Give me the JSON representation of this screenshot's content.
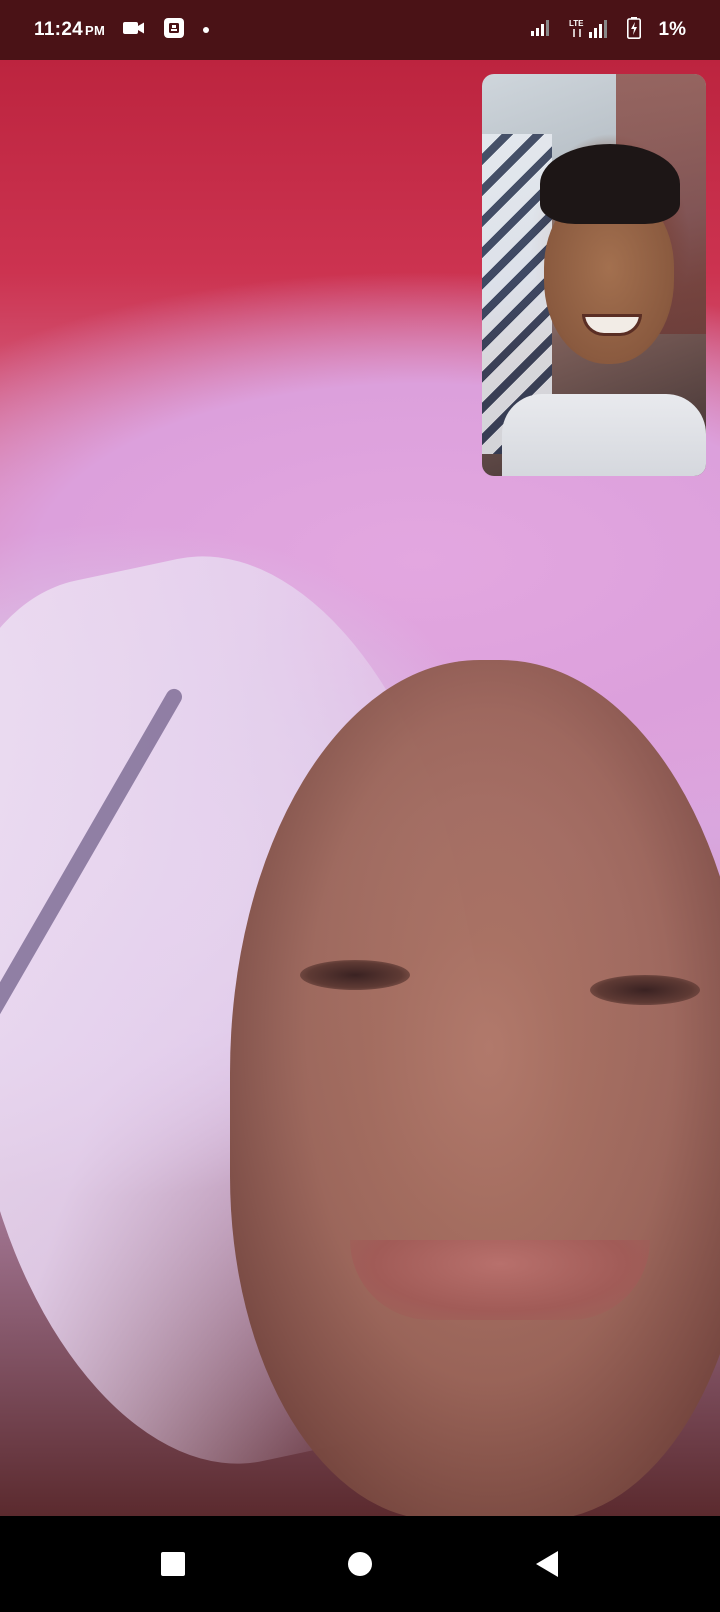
{
  "status_bar": {
    "time": "11:24",
    "ampm": "PM",
    "network_label": "LTE",
    "battery_percent": "1%",
    "icons": [
      "video-camera-icon",
      "screen-record-icon",
      "notification-dot-icon",
      "signal-bars-icon",
      "lte-signal-icon",
      "battery-icon"
    ]
  },
  "call": {
    "remote_video": "remote-participant-video",
    "local_preview": "self-view-video"
  },
  "navigation_bar": {
    "buttons": [
      "recents-square-icon",
      "home-circle-icon",
      "back-triangle-icon"
    ]
  },
  "colors": {
    "status_bar_bg": "#4a1216",
    "nav_bar_bg": "#000000",
    "icon_color": "#ffffff"
  }
}
